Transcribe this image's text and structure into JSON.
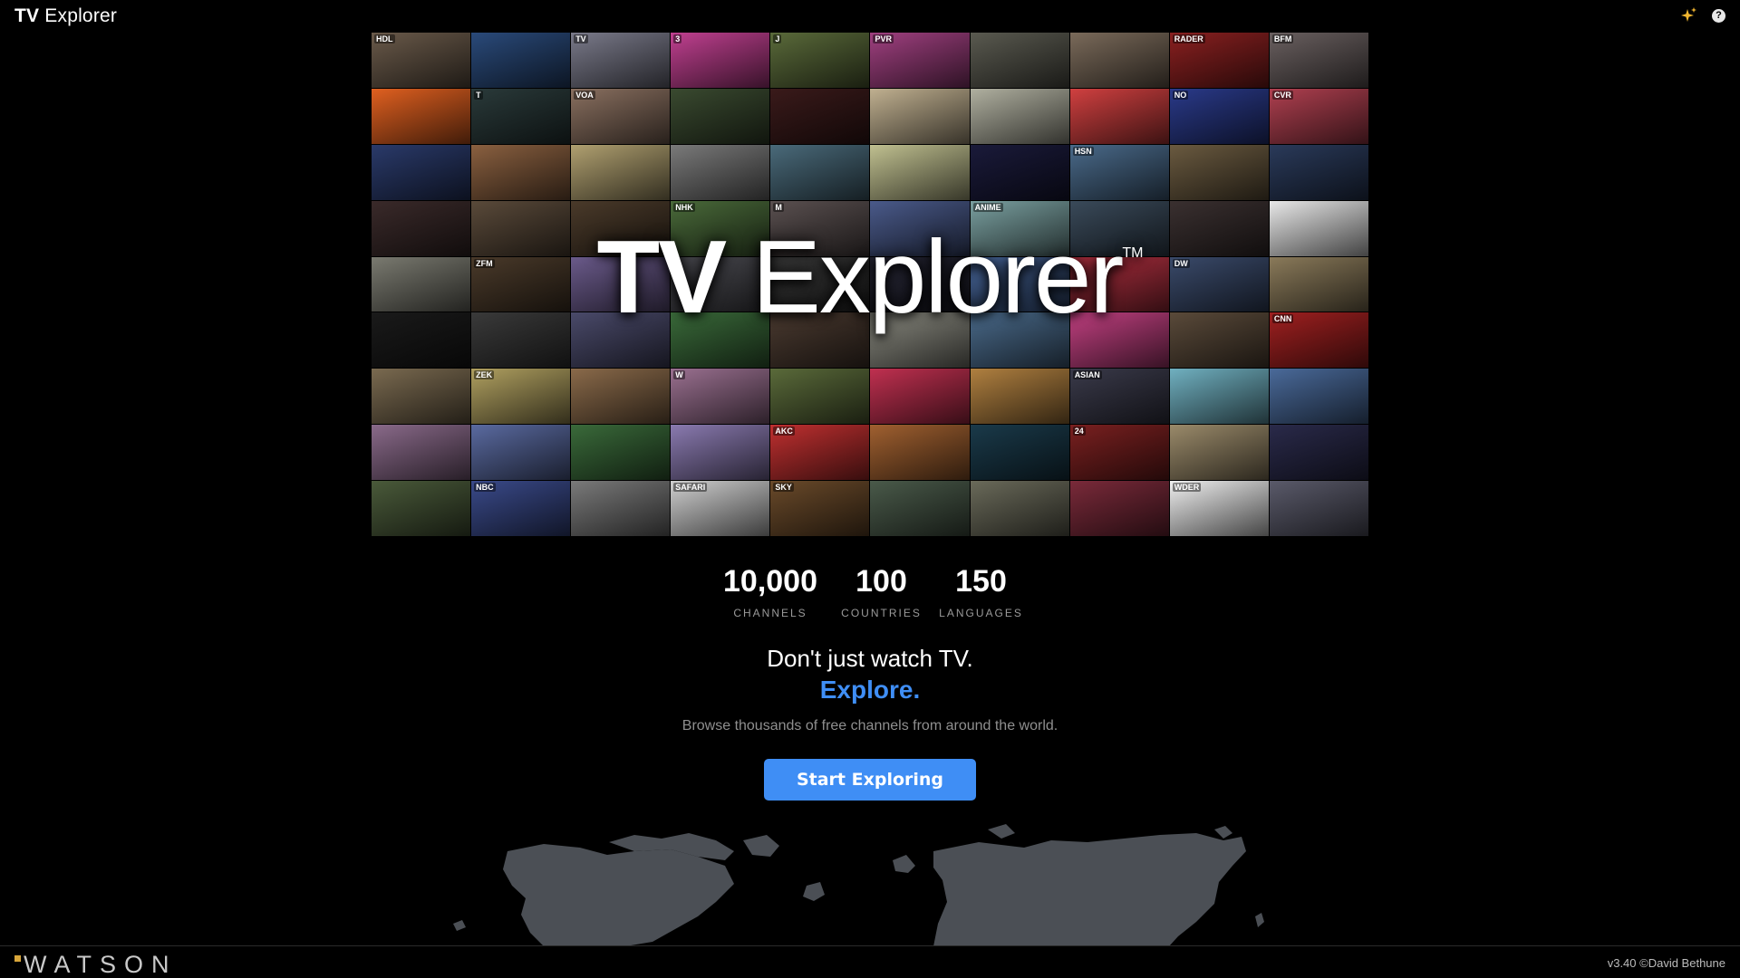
{
  "app": {
    "title_bold": "TV",
    "title_rest": " Explorer"
  },
  "icons": {
    "whats_new": "sparkle-icon",
    "help": "help-icon"
  },
  "mosaic": {
    "logo_bold": "TV",
    "logo_rest": " Explorer",
    "logo_mark": "TM",
    "tiles": [
      {
        "c": "#6a5a4a",
        "l": "HDL"
      },
      {
        "c": "#2a4a7a",
        "l": ""
      },
      {
        "c": "#7a7a8a",
        "l": "TV"
      },
      {
        "c": "#c04090",
        "l": "3"
      },
      {
        "c": "#5a6a3a",
        "l": "J"
      },
      {
        "c": "#a04080",
        "l": "PVR"
      },
      {
        "c": "#5a5a50",
        "l": ""
      },
      {
        "c": "#7a6a5a",
        "l": ""
      },
      {
        "c": "#8a2020",
        "l": "RADER"
      },
      {
        "c": "#6a6060",
        "l": "BFM"
      },
      {
        "c": "#e06020",
        "l": ""
      },
      {
        "c": "#2a3a3a",
        "l": "T"
      },
      {
        "c": "#8a7060",
        "l": "VOA"
      },
      {
        "c": "#3a4a30",
        "l": ""
      },
      {
        "c": "#3a1a1a",
        "l": ""
      },
      {
        "c": "#c0b090",
        "l": ""
      },
      {
        "c": "#b0b0a0",
        "l": ""
      },
      {
        "c": "#d04040",
        "l": ""
      },
      {
        "c": "#2a3a8a",
        "l": "NO"
      },
      {
        "c": "#b04050",
        "l": "CVR"
      },
      {
        "c": "#2a3a6a",
        "l": ""
      },
      {
        "c": "#8a6040",
        "l": ""
      },
      {
        "c": "#b0a070",
        "l": ""
      },
      {
        "c": "#7a7a7a",
        "l": ""
      },
      {
        "c": "#4a6a7a",
        "l": ""
      },
      {
        "c": "#c0c090",
        "l": ""
      },
      {
        "c": "#1a1a3a",
        "l": ""
      },
      {
        "c": "#4a6a8a",
        "l": "HSN"
      },
      {
        "c": "#6a5a40",
        "l": ""
      },
      {
        "c": "#2a3a5a",
        "l": ""
      },
      {
        "c": "#3a2a2a",
        "l": ""
      },
      {
        "c": "#5a4a3a",
        "l": ""
      },
      {
        "c": "#4a3a2a",
        "l": ""
      },
      {
        "c": "#4a6a3a",
        "l": "NHK"
      },
      {
        "c": "#5a5050",
        "l": "M"
      },
      {
        "c": "#4a5a8a",
        "l": ""
      },
      {
        "c": "#7aa0a0",
        "l": "ANIME"
      },
      {
        "c": "#3a4a5a",
        "l": ""
      },
      {
        "c": "#3a3030",
        "l": ""
      },
      {
        "c": "#e8e8e8",
        "l": ""
      },
      {
        "c": "#7a7a70",
        "l": ""
      },
      {
        "c": "#4a3a2a",
        "l": "ZFM"
      },
      {
        "c": "#6a5a8a",
        "l": ""
      },
      {
        "c": "#4a4a50",
        "l": ""
      },
      {
        "c": "#3a3a3a",
        "l": ""
      },
      {
        "c": "#2a2a3a",
        "l": ""
      },
      {
        "c": "#4a6aa0",
        "l": ""
      },
      {
        "c": "#b03040",
        "l": ""
      },
      {
        "c": "#3a4a6a",
        "l": "DW"
      },
      {
        "c": "#8a7a5a",
        "l": ""
      },
      {
        "c": "#1a1a1a",
        "l": ""
      },
      {
        "c": "#3a3a3a",
        "l": ""
      },
      {
        "c": "#4a4a6a",
        "l": ""
      },
      {
        "c": "#3a6a3a",
        "l": ""
      },
      {
        "c": "#4a3a30",
        "l": ""
      },
      {
        "c": "#8a8a80",
        "l": ""
      },
      {
        "c": "#4a6a8a",
        "l": ""
      },
      {
        "c": "#c04080",
        "l": ""
      },
      {
        "c": "#5a4a3a",
        "l": ""
      },
      {
        "c": "#a02020",
        "l": "CNN"
      },
      {
        "c": "#7a6a50",
        "l": ""
      },
      {
        "c": "#b0a060",
        "l": "ZEK"
      },
      {
        "c": "#8a6a4a",
        "l": ""
      },
      {
        "c": "#9a7090",
        "l": "W"
      },
      {
        "c": "#5a6a3a",
        "l": ""
      },
      {
        "c": "#c03050",
        "l": ""
      },
      {
        "c": "#b08040",
        "l": ""
      },
      {
        "c": "#3a3a4a",
        "l": "ASIAN"
      },
      {
        "c": "#70b0c0",
        "l": ""
      },
      {
        "c": "#4a6a9a",
        "l": ""
      },
      {
        "c": "#8a6a8a",
        "l": ""
      },
      {
        "c": "#5a6aa0",
        "l": ""
      },
      {
        "c": "#3a6a3a",
        "l": ""
      },
      {
        "c": "#8a7ab0",
        "l": ""
      },
      {
        "c": "#c03030",
        "l": "AKC"
      },
      {
        "c": "#a06030",
        "l": ""
      },
      {
        "c": "#1a3a4a",
        "l": ""
      },
      {
        "c": "#7a2020",
        "l": "24"
      },
      {
        "c": "#9a8a6a",
        "l": ""
      },
      {
        "c": "#2a2a4a",
        "l": ""
      },
      {
        "c": "#4a5a3a",
        "l": ""
      },
      {
        "c": "#3a4a8a",
        "l": "NBC"
      },
      {
        "c": "#7a7a7a",
        "l": ""
      },
      {
        "c": "#d0d0d0",
        "l": "SAFARI"
      },
      {
        "c": "#6a4a2a",
        "l": "SKY"
      },
      {
        "c": "#4a5a4a",
        "l": ""
      },
      {
        "c": "#6a6a5a",
        "l": ""
      },
      {
        "c": "#7a2a3a",
        "l": ""
      },
      {
        "c": "#f0f0f0",
        "l": "WDER"
      },
      {
        "c": "#5a5a6a",
        "l": ""
      }
    ]
  },
  "stats": [
    {
      "value": "10,000",
      "label": "CHANNELS"
    },
    {
      "value": "100",
      "label": "COUNTRIES"
    },
    {
      "value": "150",
      "label": "LANGUAGES"
    }
  ],
  "hero": {
    "tagline": "Don't just watch TV.",
    "tagline_accent": "Explore.",
    "subtext": "Browse thousands of free channels from around the world.",
    "cta_label": "Start Exploring"
  },
  "footer": {
    "brand": "WATSON",
    "version": "v3.40 ©David Bethune"
  },
  "colors": {
    "accent": "#3f8ef5",
    "brand_mark": "#d8a63a",
    "map": "#4b4f55"
  }
}
